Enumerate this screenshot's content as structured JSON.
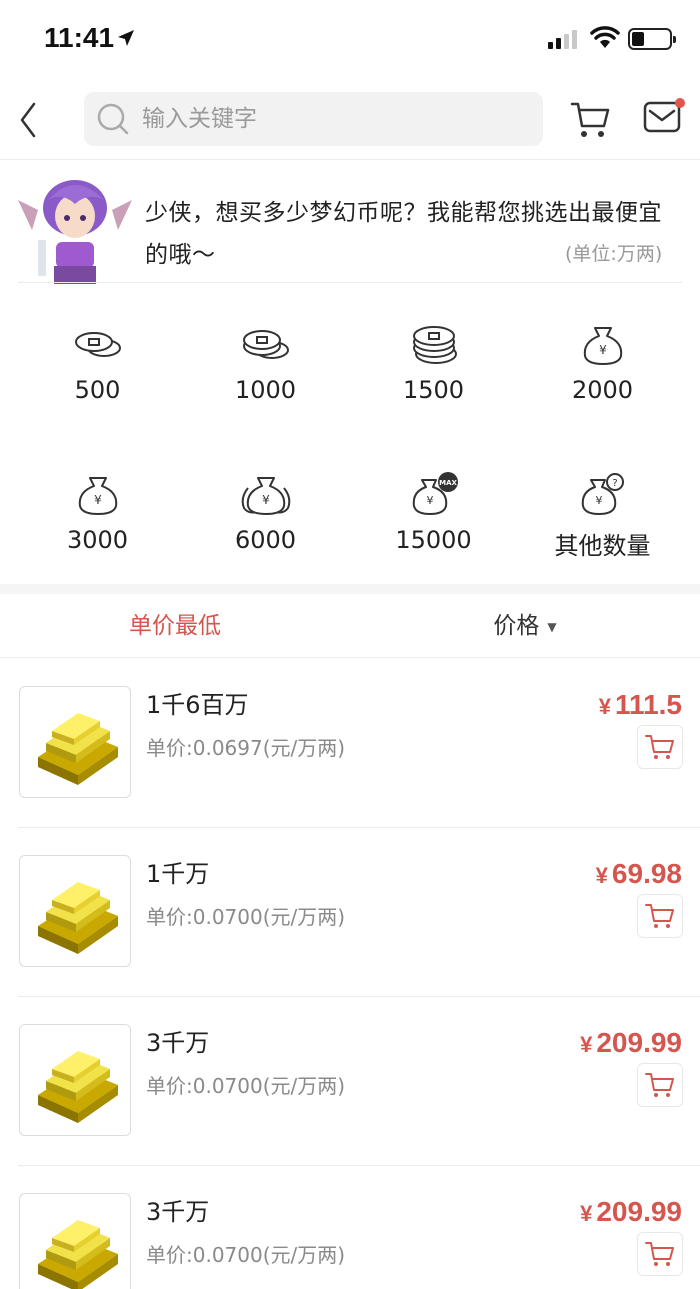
{
  "status_bar": {
    "time": "11:41"
  },
  "header": {
    "search_placeholder": "输入关键字"
  },
  "tip": {
    "message": "少侠，想买多少梦幻币呢？我能帮您挑选出最便宜的哦～",
    "unit": "(单位:万两)"
  },
  "amounts": [
    {
      "label": "500",
      "icon": "coins-small-icon"
    },
    {
      "label": "1000",
      "icon": "coins-medium-icon"
    },
    {
      "label": "1500",
      "icon": "coins-stack-icon"
    },
    {
      "label": "2000",
      "icon": "money-bag-icon"
    },
    {
      "label": "3000",
      "icon": "money-bag-icon"
    },
    {
      "label": "6000",
      "icon": "money-bags-icon"
    },
    {
      "label": "15000",
      "icon": "money-bag-max-icon"
    },
    {
      "label": "其他数量",
      "icon": "money-bag-question-icon"
    }
  ],
  "sort": {
    "lowest_label": "单价最低",
    "price_label": "价格"
  },
  "products": [
    {
      "name": "1千6百万",
      "unit_price": "单价:0.0697(元/万两)",
      "currency": "¥",
      "price": "111.5"
    },
    {
      "name": "1千万",
      "unit_price": "单价:0.0700(元/万两)",
      "currency": "¥",
      "price": "69.98"
    },
    {
      "name": "3千万",
      "unit_price": "单价:0.0700(元/万两)",
      "currency": "¥",
      "price": "209.99"
    },
    {
      "name": "3千万",
      "unit_price": "单价:0.0700(元/万两)",
      "currency": "¥",
      "price": "209.99"
    }
  ],
  "colors": {
    "accent": "#d4564e",
    "notification_dot": "#e2544c"
  }
}
